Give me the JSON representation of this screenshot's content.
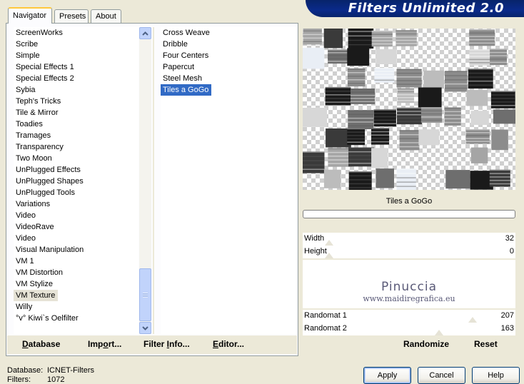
{
  "tabs": [
    "Navigator",
    "Presets",
    "About"
  ],
  "header_title": "Filters Unlimited 2.0",
  "categories": [
    "ScreenWorks",
    "Scribe",
    "Simple",
    "Special Effects 1",
    "Special Effects 2",
    "Sybia",
    "Teph's Tricks",
    "Tile & Mirror",
    "Toadies",
    "Tramages",
    "Transparency",
    "Two Moon",
    "UnPlugged Effects",
    "UnPlugged Shapes",
    "UnPlugged Tools",
    "Variations",
    "Video",
    "VideoRave",
    "Video",
    "Visual Manipulation",
    "VM 1",
    "VM Distortion",
    "VM Stylize",
    "VM Texture",
    "Willy",
    "°v° Kiwi`s Oelfilter"
  ],
  "selected_category": "VM Texture",
  "filters": [
    "Cross Weave",
    "Dribble",
    "Four Centers",
    "Papercut",
    "Steel Mesh",
    "Tiles a GoGo"
  ],
  "selected_filter": "Tiles a GoGo",
  "left_toolbar": {
    "database": "Database",
    "import": "Import...",
    "filter_info": "Filter Info...",
    "editor": "Editor..."
  },
  "filter_name": "Tiles a GoGo",
  "sliders": [
    {
      "label": "Width",
      "value": "32"
    },
    {
      "label": "Height",
      "value": "0"
    },
    {
      "label": "Randomat 1",
      "value": "207"
    },
    {
      "label": "Randomat 2",
      "value": "163"
    }
  ],
  "watermark": {
    "name": "Pinuccia",
    "url": "www.maidiregrafica.eu"
  },
  "right_toolbar": {
    "randomize": "Randomize",
    "reset": "Reset"
  },
  "status": {
    "database_label": "Database:",
    "database_value": "ICNET-Filters",
    "filters_label": "Filters:",
    "filters_value": "1072"
  },
  "buttons": {
    "apply": "Apply",
    "cancel": "Cancel",
    "help": "Help"
  }
}
